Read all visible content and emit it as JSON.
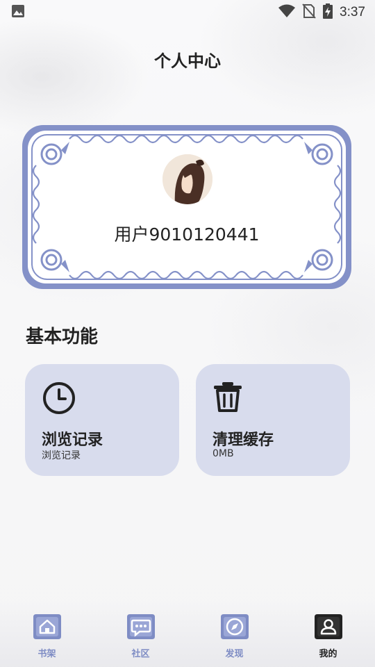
{
  "status_bar": {
    "time": "3:37",
    "icons": [
      "image-icon",
      "wifi-icon",
      "no-sim-icon",
      "battery-charging-icon"
    ]
  },
  "header": {
    "title": "个人中心"
  },
  "profile": {
    "username": "用户9010120441",
    "avatar_icon": "avatar-portrait"
  },
  "basic_functions": {
    "title": "基本功能",
    "items": [
      {
        "title": "浏览记录",
        "subtitle": "浏览记录",
        "icon": "clock-icon"
      },
      {
        "title": "清理缓存",
        "subtitle": "0MB",
        "icon": "trash-icon"
      }
    ]
  },
  "tab_bar": {
    "items": [
      {
        "label": "书架",
        "icon": "home-icon",
        "active": false
      },
      {
        "label": "社区",
        "icon": "chat-icon",
        "active": false
      },
      {
        "label": "发现",
        "icon": "compass-icon",
        "active": false
      },
      {
        "label": "我的",
        "icon": "user-icon",
        "active": true
      }
    ]
  },
  "colors": {
    "accent": "#7e8cc4",
    "card_bg": "#d8dced",
    "frame": "#8491c8",
    "text": "#222222"
  }
}
